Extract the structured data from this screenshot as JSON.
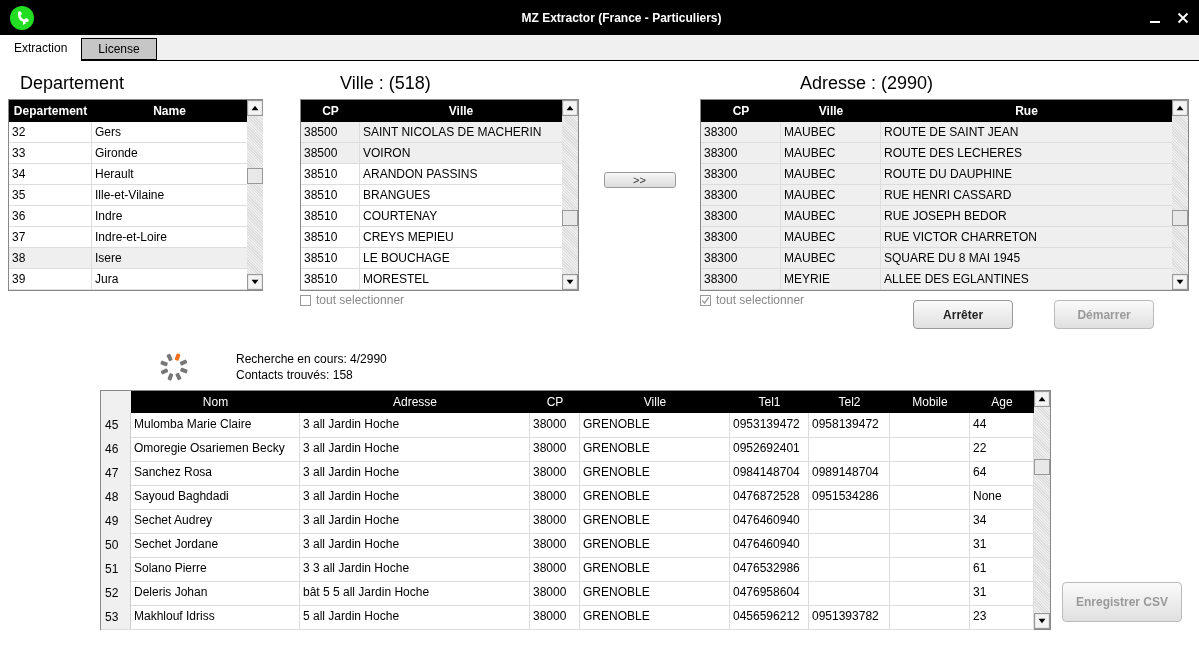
{
  "window": {
    "title": "MZ Extractor (France - Particuliers)"
  },
  "tabs": [
    {
      "label": "Extraction",
      "selected": true
    },
    {
      "label": "License",
      "selected": false
    }
  ],
  "departement": {
    "heading": "Departement",
    "columns": [
      "Departement",
      "Name"
    ],
    "rows": [
      {
        "cells": [
          "32",
          "Gers"
        ],
        "selected": false
      },
      {
        "cells": [
          "33",
          "Gironde"
        ],
        "selected": false
      },
      {
        "cells": [
          "34",
          "Herault"
        ],
        "selected": false
      },
      {
        "cells": [
          "35",
          "Ille-et-Vilaine"
        ],
        "selected": false
      },
      {
        "cells": [
          "36",
          "Indre"
        ],
        "selected": false
      },
      {
        "cells": [
          "37",
          "Indre-et-Loire"
        ],
        "selected": false
      },
      {
        "cells": [
          "38",
          "Isere"
        ],
        "selected": true
      },
      {
        "cells": [
          "39",
          "Jura"
        ],
        "selected": false
      }
    ]
  },
  "ville": {
    "heading": "Ville : (518)",
    "columns": [
      "CP",
      "Ville"
    ],
    "rows": [
      {
        "cells": [
          "38500",
          "SAINT NICOLAS DE MACHERIN"
        ],
        "selected": true
      },
      {
        "cells": [
          "38500",
          "VOIRON"
        ],
        "selected": true
      },
      {
        "cells": [
          "38510",
          "ARANDON PASSINS"
        ],
        "selected": false
      },
      {
        "cells": [
          "38510",
          "BRANGUES"
        ],
        "selected": false
      },
      {
        "cells": [
          "38510",
          "COURTENAY"
        ],
        "selected": false
      },
      {
        "cells": [
          "38510",
          "CREYS MEPIEU"
        ],
        "selected": false
      },
      {
        "cells": [
          "38510",
          "LE BOUCHAGE"
        ],
        "selected": false
      },
      {
        "cells": [
          "38510",
          "MORESTEL"
        ],
        "selected": false
      }
    ],
    "select_all": {
      "label": "tout selectionner",
      "checked": false,
      "disabled": true
    }
  },
  "transfer_button": {
    "label": ">>"
  },
  "adresse": {
    "heading": "Adresse : (2990)",
    "columns": [
      "CP",
      "Ville",
      "Rue"
    ],
    "rows": [
      {
        "cells": [
          "38300",
          "MAUBEC",
          "ROUTE DE SAINT JEAN"
        ],
        "selected": true
      },
      {
        "cells": [
          "38300",
          "MAUBEC",
          "ROUTE DES LECHERES"
        ],
        "selected": true
      },
      {
        "cells": [
          "38300",
          "MAUBEC",
          "ROUTE DU DAUPHINE"
        ],
        "selected": true
      },
      {
        "cells": [
          "38300",
          "MAUBEC",
          "RUE HENRI CASSARD"
        ],
        "selected": true
      },
      {
        "cells": [
          "38300",
          "MAUBEC",
          "RUE JOSEPH BEDOR"
        ],
        "selected": true
      },
      {
        "cells": [
          "38300",
          "MAUBEC",
          "RUE VICTOR CHARRETON"
        ],
        "selected": true
      },
      {
        "cells": [
          "38300",
          "MAUBEC",
          "SQUARE DU 8 MAI 1945"
        ],
        "selected": true
      },
      {
        "cells": [
          "38300",
          "MEYRIE",
          "ALLEE DES EGLANTINES"
        ],
        "selected": true
      }
    ],
    "select_all": {
      "label": "tout selectionner",
      "checked": true,
      "disabled": true
    }
  },
  "buttons": [
    {
      "label": "Arrêter",
      "disabled": false
    },
    {
      "label": "Démarrer",
      "disabled": true
    }
  ],
  "progress": {
    "lines": [
      "Recherche en cours: 4/2990",
      "Contacts trouvés: 158"
    ]
  },
  "contacts": {
    "columns": [
      "Nom",
      "Adresse",
      "CP",
      "Ville",
      "Tel1",
      "Tel2",
      "Mobile",
      "Age"
    ],
    "rows": [
      {
        "num": "45",
        "cells": [
          "Mulomba Marie Claire",
          "3 all Jardin Hoche",
          "38000",
          "GRENOBLE",
          "0953139472",
          "0958139472",
          null,
          "44"
        ]
      },
      {
        "num": "46",
        "cells": [
          "Omoregie Osariemen Becky",
          "3 all Jardin Hoche",
          "38000",
          "GRENOBLE",
          "0952692401",
          null,
          null,
          "22"
        ]
      },
      {
        "num": "47",
        "cells": [
          "Sanchez Rosa",
          "3 all Jardin Hoche",
          "38000",
          "GRENOBLE",
          "0984148704",
          "0989148704",
          null,
          "64"
        ]
      },
      {
        "num": "48",
        "cells": [
          "Sayoud Baghdadi",
          "3 all Jardin Hoche",
          "38000",
          "GRENOBLE",
          "0476872528",
          "0951534286",
          null,
          "None"
        ]
      },
      {
        "num": "49",
        "cells": [
          "Sechet Audrey",
          "3 all Jardin Hoche",
          "38000",
          "GRENOBLE",
          "0476460940",
          null,
          null,
          "34"
        ]
      },
      {
        "num": "50",
        "cells": [
          "Sechet Jordane",
          "3 all Jardin Hoche",
          "38000",
          "GRENOBLE",
          "0476460940",
          null,
          null,
          "31"
        ]
      },
      {
        "num": "51",
        "cells": [
          "Solano Pierre",
          "3 3 all Jardin Hoche",
          "38000",
          "GRENOBLE",
          "0476532986",
          null,
          null,
          "61"
        ]
      },
      {
        "num": "52",
        "cells": [
          "Deleris Johan",
          "bât 5 5 all Jardin Hoche",
          "38000",
          "GRENOBLE",
          "0476958604",
          null,
          null,
          "31"
        ]
      },
      {
        "num": "53",
        "cells": [
          "Makhlouf Idriss",
          "5 all Jardin Hoche",
          "38000",
          "GRENOBLE",
          "0456596212",
          "0951393782",
          null,
          "23"
        ]
      }
    ]
  },
  "save_button": {
    "label": "Enregistrer CSV",
    "disabled": true
  }
}
